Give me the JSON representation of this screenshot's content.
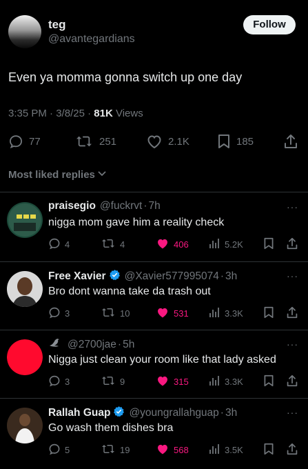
{
  "post": {
    "display_name": "teg",
    "handle": "@avantegardians",
    "follow_label": "Follow",
    "text": "Even ya momma gonna switch up one day",
    "time": "3:35 PM",
    "date": "3/8/25",
    "views_count": "81K",
    "views_label": "Views",
    "replies": "77",
    "reposts": "251",
    "likes": "2.1K",
    "bookmarks": "185"
  },
  "sort_label": "Most liked replies",
  "replies": [
    {
      "name": "praisegio",
      "handle": "@fuckrvt",
      "time": "7h",
      "text": "nigga mom gave him a reality check",
      "replies": "4",
      "reposts": "4",
      "likes": "406",
      "views": "5.2K",
      "verified": false
    },
    {
      "name": "Free Xavier",
      "handle": "@Xavier577995074",
      "time": "3h",
      "text": "Bro dont wanna take da trash out",
      "replies": "3",
      "reposts": "10",
      "likes": "531",
      "views": "3.3K",
      "verified": true
    },
    {
      "name": "",
      "handle": "@2700jae",
      "time": "5h",
      "text": "Nigga just clean your room like that lady asked",
      "replies": "3",
      "reposts": "9",
      "likes": "315",
      "views": "3.3K",
      "verified": false
    },
    {
      "name": "Rallah Guap",
      "handle": "@youngrallahguap",
      "time": "3h",
      "text": "Go wash them dishes bra",
      "replies": "5",
      "reposts": "19",
      "likes": "568",
      "views": "3.5K",
      "verified": true
    }
  ],
  "colors": {
    "background": "#000000",
    "text": "#e7e9ea",
    "secondary": "#71767b",
    "like_active": "#f91880",
    "verified": "#1d9bf0"
  }
}
